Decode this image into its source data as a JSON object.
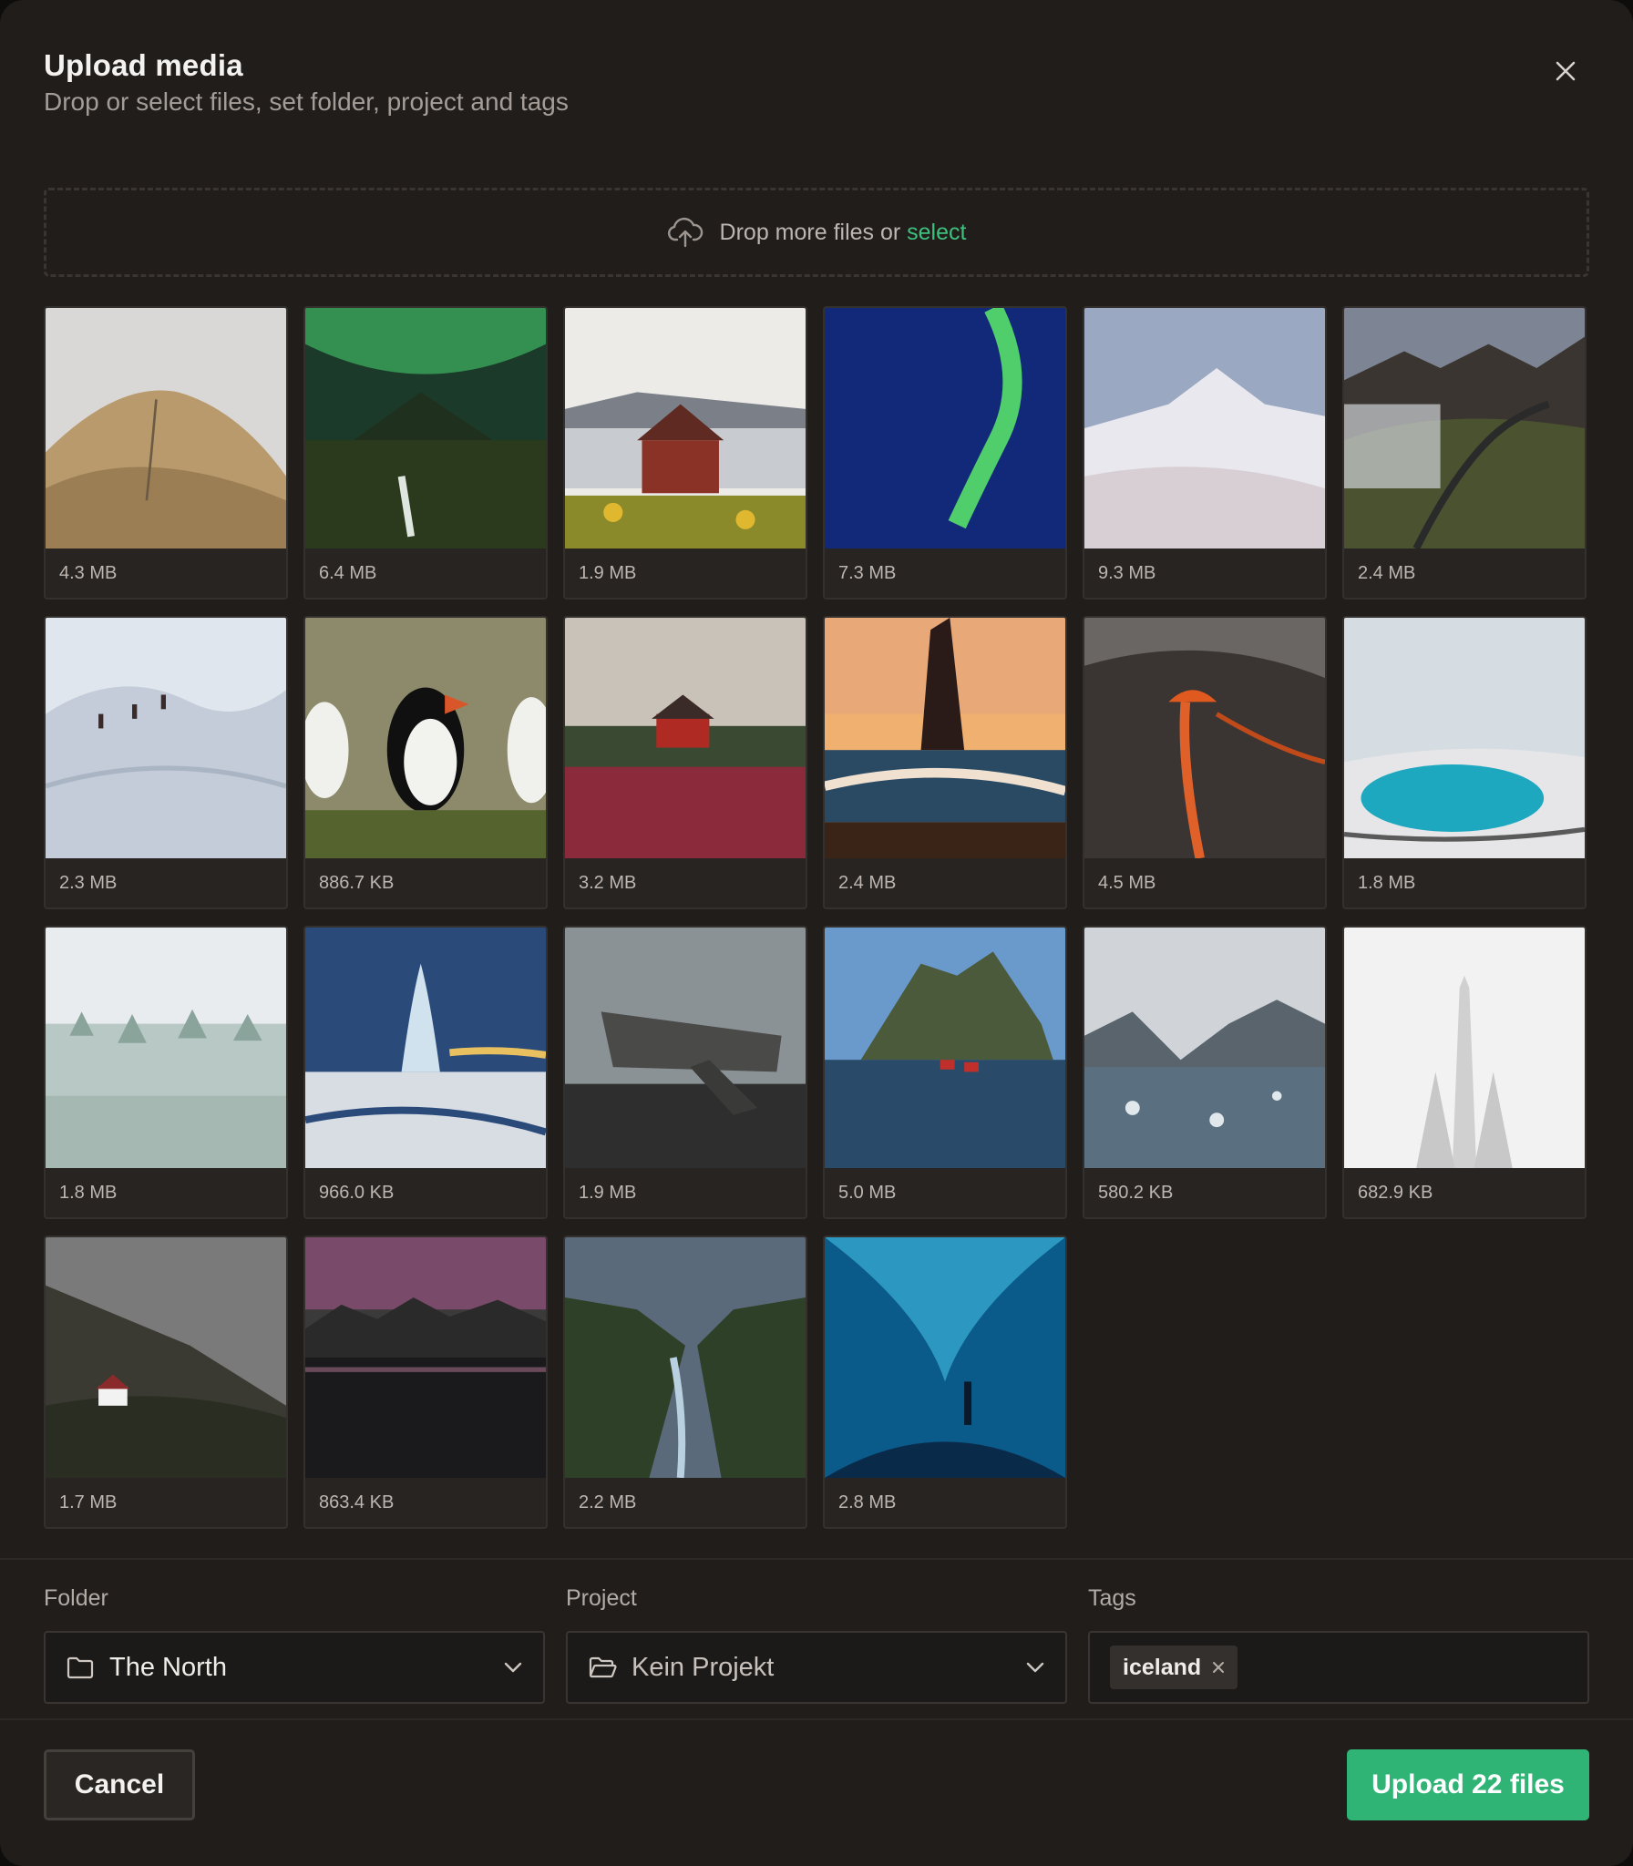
{
  "header": {
    "title": "Upload media",
    "subtitle": "Drop or select files, set folder, project and tags"
  },
  "dropzone": {
    "text": "Drop more files or",
    "link": "select"
  },
  "files": [
    {
      "size": "4.3 MB",
      "subject": "foggy-mountain-trail"
    },
    {
      "size": "6.4 MB",
      "subject": "aurora-over-kirkjufell"
    },
    {
      "size": "1.9 MB",
      "subject": "red-cabin-by-fjord"
    },
    {
      "size": "7.3 MB",
      "subject": "aurora-night-sky"
    },
    {
      "size": "9.3 MB",
      "subject": "snowy-peak"
    },
    {
      "size": "2.4 MB",
      "subject": "valley-road-aerial"
    },
    {
      "size": "2.3 MB",
      "subject": "glacier-hikers"
    },
    {
      "size": "886.7 KB",
      "subject": "puffins"
    },
    {
      "size": "3.2 MB",
      "subject": "red-house-meadow"
    },
    {
      "size": "2.4 MB",
      "subject": "sea-stack-sunset"
    },
    {
      "size": "4.5 MB",
      "subject": "volcano-lava"
    },
    {
      "size": "1.8 MB",
      "subject": "blue-crater-lake"
    },
    {
      "size": "1.8 MB",
      "subject": "frosted-forest"
    },
    {
      "size": "966.0 KB",
      "subject": "geyser-eruption"
    },
    {
      "size": "1.9 MB",
      "subject": "plane-wreck"
    },
    {
      "size": "5.0 MB",
      "subject": "fishing-village-cliffs"
    },
    {
      "size": "580.2 KB",
      "subject": "icy-fjord"
    },
    {
      "size": "682.9 KB",
      "subject": "hallgrimskirkja-church"
    },
    {
      "size": "1.7 MB",
      "subject": "cottage-under-mountain"
    },
    {
      "size": "863.4 KB",
      "subject": "mountain-lake-dusk"
    },
    {
      "size": "2.2 MB",
      "subject": "canyon-river"
    },
    {
      "size": "2.8 MB",
      "subject": "ice-cave"
    }
  ],
  "form": {
    "folder": {
      "label": "Folder",
      "value": "The North"
    },
    "project": {
      "label": "Project",
      "value": "Kein Projekt"
    },
    "tags": {
      "label": "Tags",
      "items": [
        "iceland"
      ]
    }
  },
  "footer": {
    "cancel_label": "Cancel",
    "upload_label": "Upload 22 files"
  },
  "colors": {
    "accent": "#2fb476",
    "link": "#3ec07e",
    "background": "#201d1b"
  }
}
